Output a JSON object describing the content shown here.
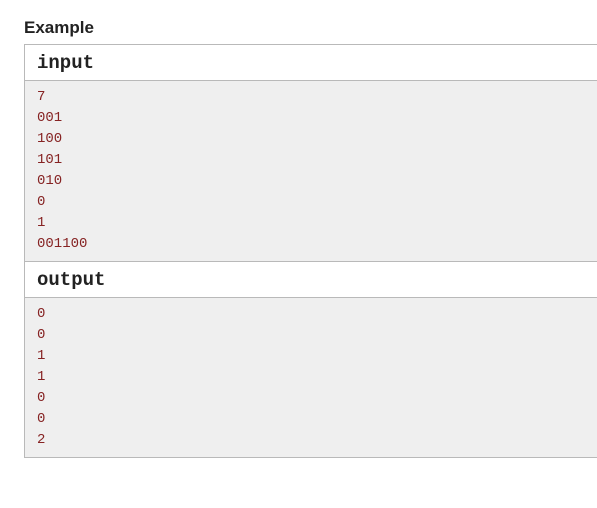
{
  "title": "Example",
  "input": {
    "header": "input",
    "lines": [
      "7",
      "001",
      "100",
      "101",
      "010",
      "0",
      "1",
      "001100"
    ]
  },
  "output": {
    "header": "output",
    "lines": [
      "0",
      "0",
      "1",
      "1",
      "0",
      "0",
      "2"
    ]
  }
}
